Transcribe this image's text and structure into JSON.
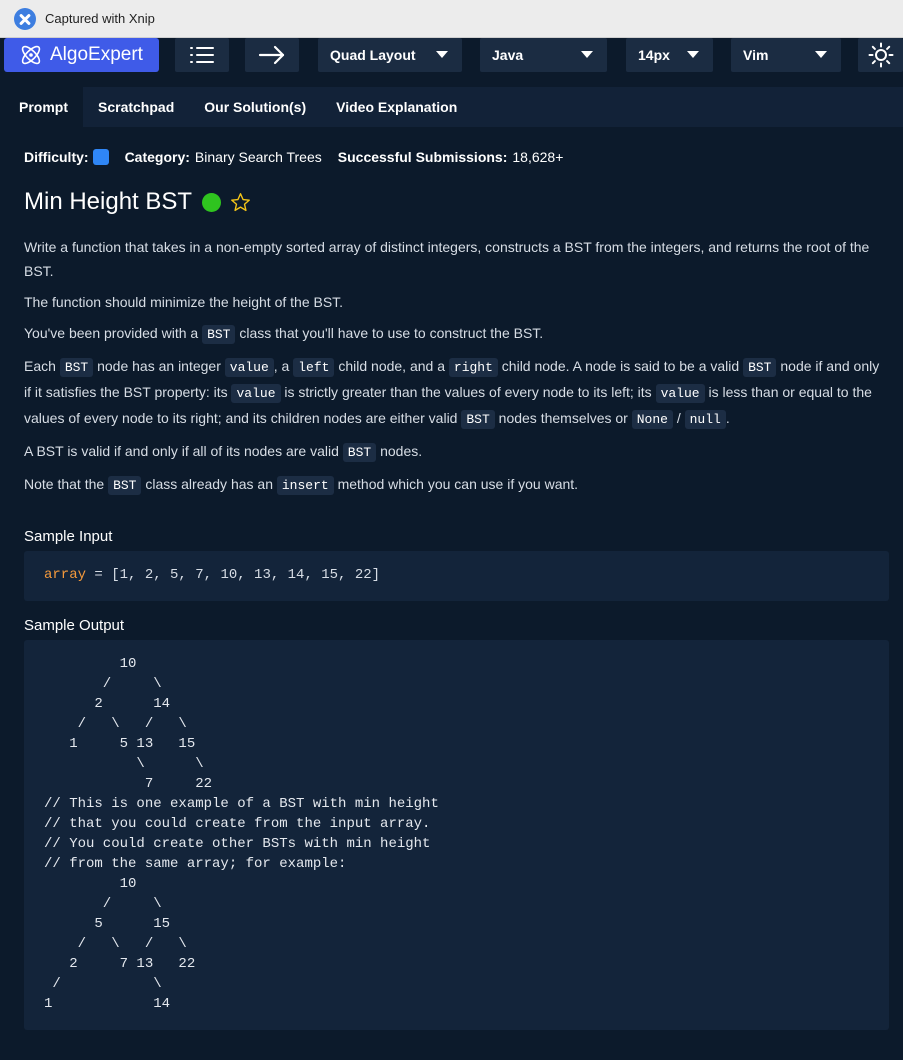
{
  "capture": {
    "text": "Captured with Xnip"
  },
  "toolbar": {
    "brand": "AlgoExpert",
    "layout": "Quad Layout",
    "language": "Java",
    "font_size": "14px",
    "keymap": "Vim"
  },
  "tabs": [
    "Prompt",
    "Scratchpad",
    "Our Solution(s)",
    "Video Explanation"
  ],
  "meta": {
    "difficulty_label": "Difficulty:",
    "category_label": "Category:",
    "category": "Binary Search Trees",
    "submissions_label": "Successful Submissions:",
    "submissions": "18,628+"
  },
  "title": "Min Height BST",
  "prompt": {
    "p1": "Write a function that takes in a non-empty sorted array of distinct integers, constructs a BST from the integers, and returns the root of the BST.",
    "p2": "The function should minimize the height of the BST.",
    "p3a": "You've been provided with a ",
    "p3code": "BST",
    "p3b": " class that you'll have to use to construct the BST.",
    "p4": {
      "t1": "Each ",
      "c1": "BST",
      "t2": " node has an integer ",
      "c2": "value",
      "t3": ", a ",
      "c3": "left",
      "t4": " child node, and a ",
      "c4": "right",
      "t5": " child node. A node is said to be a valid ",
      "c5": "BST",
      "t6": " node if and only if it satisfies the BST property: its ",
      "c6": "value",
      "t7": " is strictly greater than the values of every node to its left; its ",
      "c7": "value",
      "t8": " is less than or equal to the values of every node to its right; and its children nodes are either valid ",
      "c8": "BST",
      "t9": " nodes themselves or ",
      "c9": "None",
      "t10": " / ",
      "c10": "null",
      "t11": "."
    },
    "p5": {
      "t1": "A BST is valid if and only if all of its nodes are valid ",
      "c1": "BST",
      "t2": " nodes."
    },
    "p6": {
      "t1": "Note that the ",
      "c1": "BST",
      "t2": " class already has an ",
      "c2": "insert",
      "t3": " method which you can use if you want."
    }
  },
  "sample_input": {
    "heading": "Sample Input",
    "var": "array",
    "rest": " = [1, 2, 5, 7, 10, 13, 14, 15, 22]"
  },
  "sample_output": {
    "heading": "Sample Output",
    "tree1": "         10\n       /     \\\n      2      14\n    /   \\   /   \\\n   1     5 13   15\n           \\      \\\n            7     22",
    "comment": "// This is one example of a BST with min height\n// that you could create from the input array.\n// You could create other BSTs with min height\n// from the same array; for example:",
    "tree2": "         10\n       /     \\\n      5      15\n    /   \\   /   \\\n   2     7 13   22\n /           \\\n1            14"
  },
  "colors": {
    "brand": "#3f5be8",
    "difficulty": "#2f86f6",
    "status": "#2fc41f",
    "star": "#f5c518",
    "variable": "#f59a3c"
  }
}
